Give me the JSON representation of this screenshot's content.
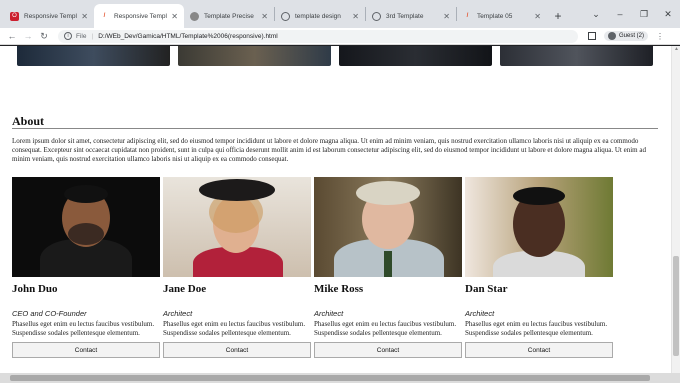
{
  "browser": {
    "tabs": [
      {
        "title": "Responsive Template",
        "icon": "opera-icon",
        "color": "#cc1f2f",
        "active": false
      },
      {
        "title": "Responsive Template",
        "icon": "html-file-icon",
        "color": "#e34c26",
        "active": true
      },
      {
        "title": "Template Precise",
        "icon": "globe-icon",
        "color": "#888888",
        "active": false
      },
      {
        "title": "template design",
        "icon": "globe-icon",
        "color": "#5f6368",
        "active": false
      },
      {
        "title": "3rd Template",
        "icon": "globe-icon",
        "color": "#5f6368",
        "active": false
      },
      {
        "title": "Template 05",
        "icon": "html-file-icon",
        "color": "#e34c26",
        "active": false
      }
    ],
    "address": {
      "scheme": "File",
      "path": "D:/WEb_Dev/Gamica/HTML/Template%2006(responsive).html"
    },
    "profile": "Guest (2)"
  },
  "page": {
    "about": {
      "title": "About",
      "text": "Lorem ipsum dolor sit amet, consectetur adipiscing elit, sed do eiusmod tempor incididunt ut labore et dolore magna aliqua. Ut enim ad minim veniam, quis nostrud exercitation ullamco laboris nisi ut aliquip ex ea commodo consequat. Excepteur sint occaecat cupidatat non proident, sunt in culpa qui officia deserunt mollit anim id est laborum consectetur adipiscing elit, sed do eiusmod tempor incididunt ut labore et dolore magna aliqua. Ut enim ad minim veniam, quis nostrud exercitation ullamco laboris nisi ut aliquip ex ea commodo consequat."
    },
    "team": [
      {
        "name": "John Duo",
        "role": "CEO and CO-Founder",
        "desc": "Phasellus eget enim eu lectus faucibus vestibulum. Suspendisse sodales pellentesque elementum.",
        "button": "Contact"
      },
      {
        "name": "Jane Doe",
        "role": "Architect",
        "desc": "Phasellus eget enim eu lectus faucibus vestibulum. Suspendisse sodales pellentesque elementum.",
        "button": "Contact"
      },
      {
        "name": "Mike Ross",
        "role": "Architect",
        "desc": "Phasellus eget enim eu lectus faucibus vestibulum. Suspendisse sodales pellentesque elementum.",
        "button": "Contact"
      },
      {
        "name": "Dan Star",
        "role": "Architect",
        "desc": "Phasellus eget enim eu lectus faucibus vestibulum. Suspendisse sodales pellentesque elementum.",
        "button": "Contact"
      }
    ]
  }
}
